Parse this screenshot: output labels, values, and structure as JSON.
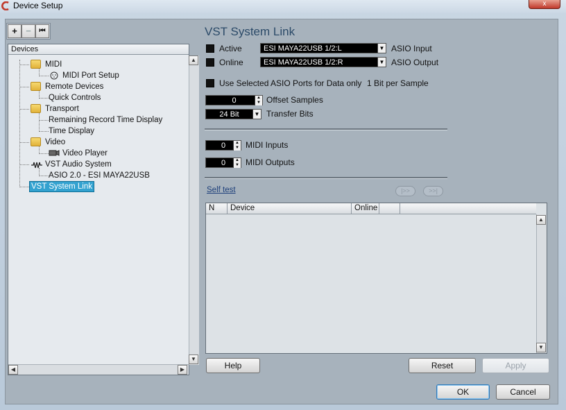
{
  "window": {
    "title": "Device Setup",
    "close_glyph": "x"
  },
  "toolbar": {
    "add_glyph": "+",
    "remove_glyph": "−",
    "reset_glyph": "⏮"
  },
  "tree": {
    "header": "Devices",
    "items": [
      {
        "label": "MIDI",
        "icon": "folder-icon"
      },
      {
        "label": "MIDI Port Setup",
        "icon": "midi-port-icon"
      },
      {
        "label": "Remote Devices",
        "icon": "folder-icon"
      },
      {
        "label": "Quick Controls",
        "icon": ""
      },
      {
        "label": "Transport",
        "icon": "folder-icon"
      },
      {
        "label": "Remaining Record Time Display",
        "icon": ""
      },
      {
        "label": "Time Display",
        "icon": ""
      },
      {
        "label": "Video",
        "icon": "folder-icon"
      },
      {
        "label": "Video Player",
        "icon": "video-player-icon"
      },
      {
        "label": "VST Audio System",
        "icon": "audio-system-icon"
      },
      {
        "label": "ASIO 2.0 - ESI MAYA22USB",
        "icon": ""
      },
      {
        "label": "VST System Link",
        "icon": "",
        "selected": true
      }
    ]
  },
  "panel": {
    "title": "VST System Link",
    "active_label": "Active",
    "online_label": "Online",
    "asio_input_value": "ESI MAYA22USB 1/2:L",
    "asio_input_label": "ASIO Input",
    "asio_output_value": "ESI MAYA22USB 1/2:R",
    "asio_output_label": "ASIO Output",
    "use_selected_label": "Use Selected ASIO Ports for Data only",
    "bit_per_sample": "1 Bit per Sample",
    "offset_value": "0",
    "offset_label": "Offset Samples",
    "transfer_value": "24 Bit",
    "transfer_label": "Transfer Bits",
    "midi_inputs_value": "0",
    "midi_inputs_label": "MIDI Inputs",
    "midi_outputs_value": "0",
    "midi_outputs_label": "MIDI Outputs",
    "self_test": "Self test",
    "nav_prev": "|>>",
    "nav_next": ">>|"
  },
  "table": {
    "columns": [
      "N",
      "Device",
      "Online",
      ""
    ],
    "rows": []
  },
  "buttons": {
    "help": "Help",
    "reset": "Reset",
    "apply": "Apply",
    "ok": "OK",
    "cancel": "Cancel"
  },
  "colors": {
    "accent": "#33a2d0",
    "title": "#2b4a68"
  }
}
